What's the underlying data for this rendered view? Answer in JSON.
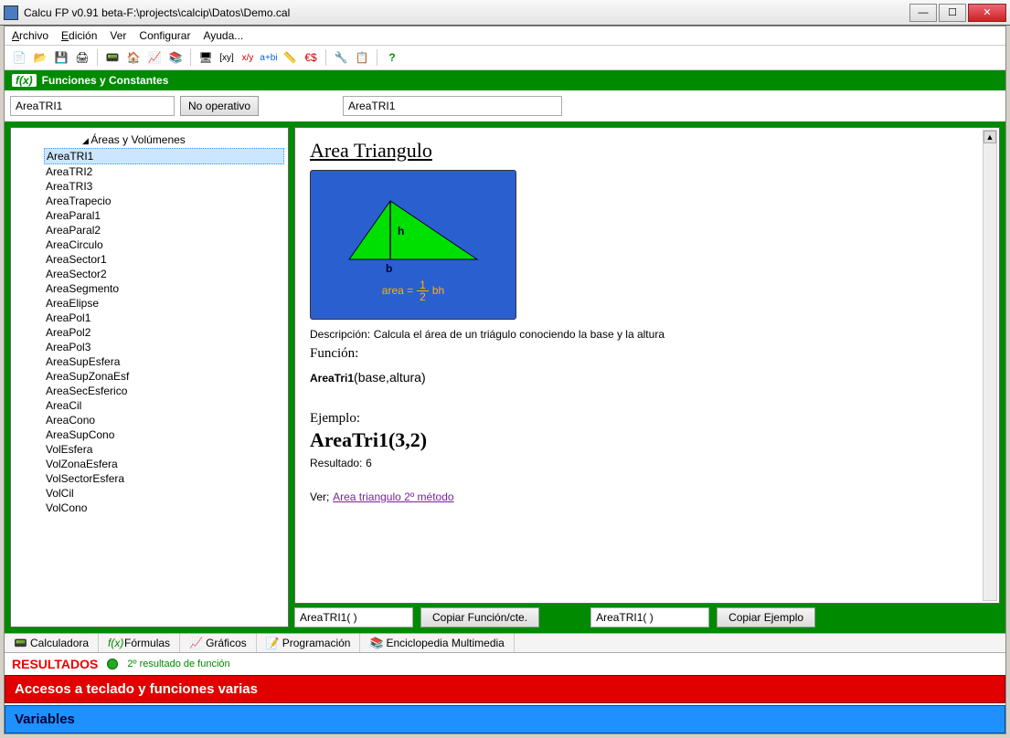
{
  "window": {
    "title": "Calcu FP  v0.91 beta-F:\\projects\\calcip\\Datos\\Demo.cal"
  },
  "menu": {
    "archivo": "Archivo",
    "edicion": "Edición",
    "ver": "Ver",
    "configurar": "Configurar",
    "ayuda": "Ayuda..."
  },
  "section": {
    "title": "Funciones y Constantes"
  },
  "filter": {
    "left_value": "AreaTRI1",
    "btn": "No operativo",
    "right_value": "AreaTRI1"
  },
  "tree": {
    "header": "Áreas y Volúmenes",
    "items": [
      "AreaTRI1",
      "AreaTRI2",
      "AreaTRI3",
      "AreaTrapecio",
      "AreaParal1",
      "AreaParal2",
      "AreaCirculo",
      "AreaSector1",
      "AreaSector2",
      "AreaSegmento",
      "AreaElipse",
      "AreaPol1",
      "AreaPol2",
      "AreaPol3",
      "AreaSupEsfera",
      "AreaSupZonaEsf",
      "AreaSecEsferico",
      "AreaCil",
      "AreaCono",
      "AreaSupCono",
      "VolEsfera",
      "VolZonaEsfera",
      "VolSectorEsfera",
      "VolCil",
      "VolCono"
    ]
  },
  "detail": {
    "title": "Area Triangulo",
    "fig_labels": {
      "h": "h",
      "b": "b",
      "formula_prefix": "area =",
      "formula_suffix": "bh"
    },
    "desc_label": "Descripción:",
    "desc_text": "Calcula el área de un triágulo conociendo la base y la altura",
    "func_label": "Función:",
    "func_name": "AreaTri1",
    "func_args": "(base,altura)",
    "ex_label": "Ejemplo:",
    "ex_call": "AreaTri1(3,2)",
    "ex_result_label": "Resultado:",
    "ex_result_value": "6",
    "see_label": "Ver;",
    "see_link": "Area triangulo 2º método"
  },
  "copy": {
    "left_value": "AreaTRI1( )",
    "btn1": "Copiar Función/cte.",
    "right_value": "AreaTRI1( )",
    "btn2": "Copiar Ejemplo"
  },
  "tabs": {
    "calc": "Calculadora",
    "formulas": "Fórmulas",
    "graf": "Gráficos",
    "prog": "Programación",
    "encic": "Enciclopedia Multimedia"
  },
  "results": {
    "label": "RESULTADOS",
    "sub": "2º resultado de función"
  },
  "bar_red": "Accesos a teclado y funciones varias",
  "bar_blue": "Variables"
}
